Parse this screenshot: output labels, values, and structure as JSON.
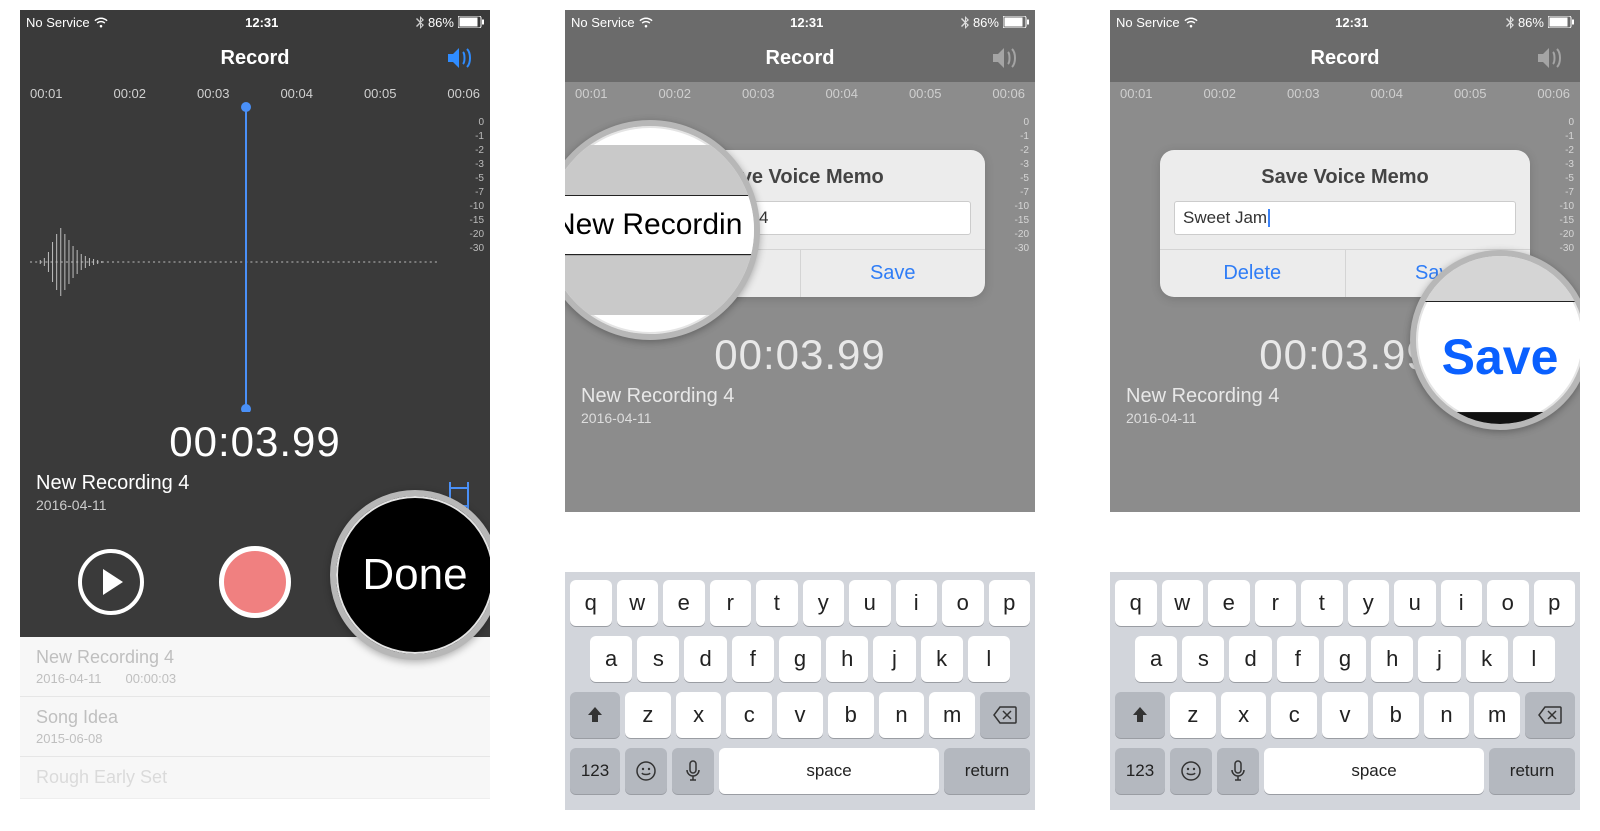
{
  "status": {
    "carrier": "No Service",
    "time": "12:31",
    "battery": "86%"
  },
  "title": "Record",
  "ticks": [
    "00:01",
    "00:02",
    "00:03",
    "00:04",
    "00:05",
    "00:06"
  ],
  "db": [
    "0",
    "-1",
    "-2",
    "-3",
    "-5",
    "-7",
    "-10",
    "-15",
    "-20",
    "-30"
  ],
  "bigtime": "00:03.99",
  "recname": "New Recording 4",
  "recdate": "2016-04-11",
  "done_label": "Done",
  "list": [
    {
      "name": "New Recording 4",
      "date": "2016-04-11",
      "dur": "00:00:03"
    },
    {
      "name": "Song Idea",
      "date": "2015-06-08",
      "dur": ""
    },
    {
      "name": "Rough Early Set",
      "date": "",
      "dur": ""
    }
  ],
  "dialog": {
    "title": "Save Voice Memo",
    "input1": "New Recording 4",
    "input2": "Sweet Jam",
    "delete": "Delete",
    "save": "Save"
  },
  "keyboard": {
    "row1": [
      "q",
      "w",
      "e",
      "r",
      "t",
      "y",
      "u",
      "i",
      "o",
      "p"
    ],
    "row2": [
      "a",
      "s",
      "d",
      "f",
      "g",
      "h",
      "j",
      "k",
      "l"
    ],
    "row3": [
      "z",
      "x",
      "c",
      "v",
      "b",
      "n",
      "m"
    ],
    "num": "123",
    "space": "space",
    "return": "return"
  },
  "callout": {
    "done": "Done",
    "input_text": "New Recordin",
    "save": "Save"
  }
}
